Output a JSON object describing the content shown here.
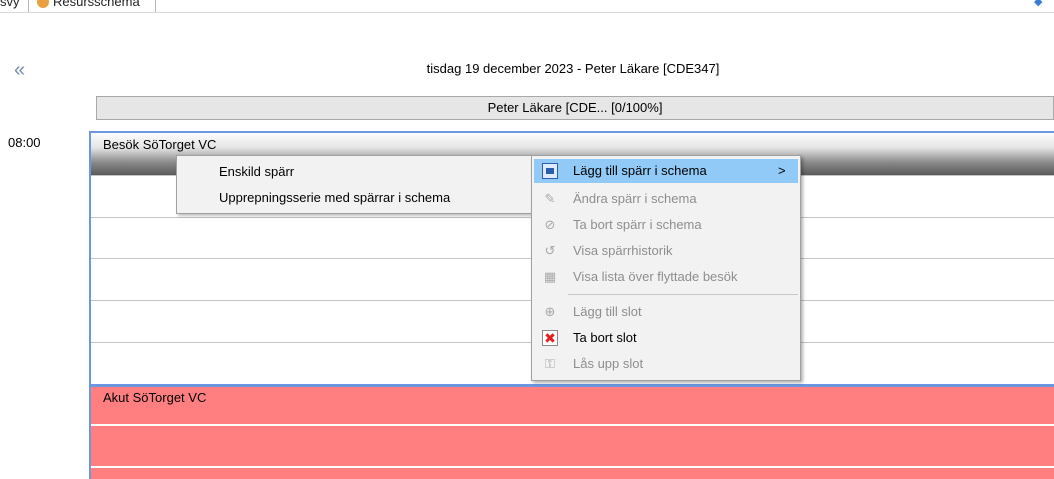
{
  "tabs": {
    "previous_fragment": "svy",
    "current_label": "Resursschema"
  },
  "schedule": {
    "day_title": "tisdag 19 december 2023 - Peter Läkare [CDE347]",
    "resource_header": "Peter Läkare [CDE...  [0/100%]",
    "time_label": "08:00",
    "blocks": [
      {
        "title": "Besök SöTorget VC",
        "color": "#e6e6e6"
      },
      {
        "title": "Akut SöTorget VC",
        "color": "#ff7f80"
      }
    ]
  },
  "submenu": {
    "items": [
      {
        "label": "Enskild spärr"
      },
      {
        "label": "Upprepningsserie med spärrar i schema"
      }
    ]
  },
  "context_menu": {
    "items": [
      {
        "label": "Lägg till spärr i schema",
        "icon": "block-schedule-icon",
        "enabled": true,
        "highlighted": true,
        "has_submenu": true
      },
      {
        "label": "Ändra spärr i schema",
        "icon": "pencil-icon",
        "enabled": false
      },
      {
        "label": "Ta bort spärr i schema",
        "icon": "no-entry-icon",
        "enabled": false
      },
      {
        "label": "Visa spärrhistorik",
        "icon": "history-icon",
        "enabled": false
      },
      {
        "label": "Visa lista över flyttade besök",
        "icon": "calendar-icon",
        "enabled": false
      },
      {
        "label": "Lägg till slot",
        "icon": "add-circle-icon",
        "enabled": false
      },
      {
        "label": "Ta bort slot",
        "icon": "remove-slot-icon",
        "enabled": true
      },
      {
        "label": "Lås upp slot",
        "icon": "unlock-icon",
        "enabled": false
      }
    ],
    "submenu_arrow": ">"
  },
  "colors": {
    "accent": "#6a97e0",
    "highlight": "#91c9f7",
    "akut": "#ff7f80"
  }
}
